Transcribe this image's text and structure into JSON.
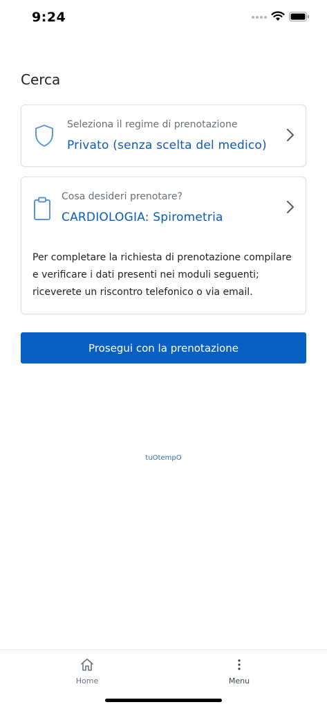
{
  "status_bar": {
    "time": "9:24"
  },
  "page": {
    "title": "Cerca"
  },
  "regime_card": {
    "icon": "shield-icon",
    "label": "Seleziona il regime di prenotazione",
    "value": "Privato (senza scelta del medico)"
  },
  "prestazione_card": {
    "icon": "clipboard-icon",
    "label": "Cosa desideri prenotare?",
    "value": "CARDIOLOGIA: Spirometria",
    "note": "Per completare la richiesta di prenotazione compilare e verificare i dati presenti nei moduli seguenti; riceverete un riscontro telefonico o via email."
  },
  "actions": {
    "proceed_label": "Prosegui con la prenotazione"
  },
  "brand": {
    "text": "tuOtempO"
  },
  "tab_bar": {
    "items": [
      {
        "label": "Home",
        "icon": "home-icon"
      },
      {
        "label": "Menu",
        "icon": "more-vertical-icon"
      }
    ]
  },
  "colors": {
    "accent": "#0a5fc2",
    "link_text": "#0a5cba",
    "icon_blue": "#4a90d9"
  }
}
